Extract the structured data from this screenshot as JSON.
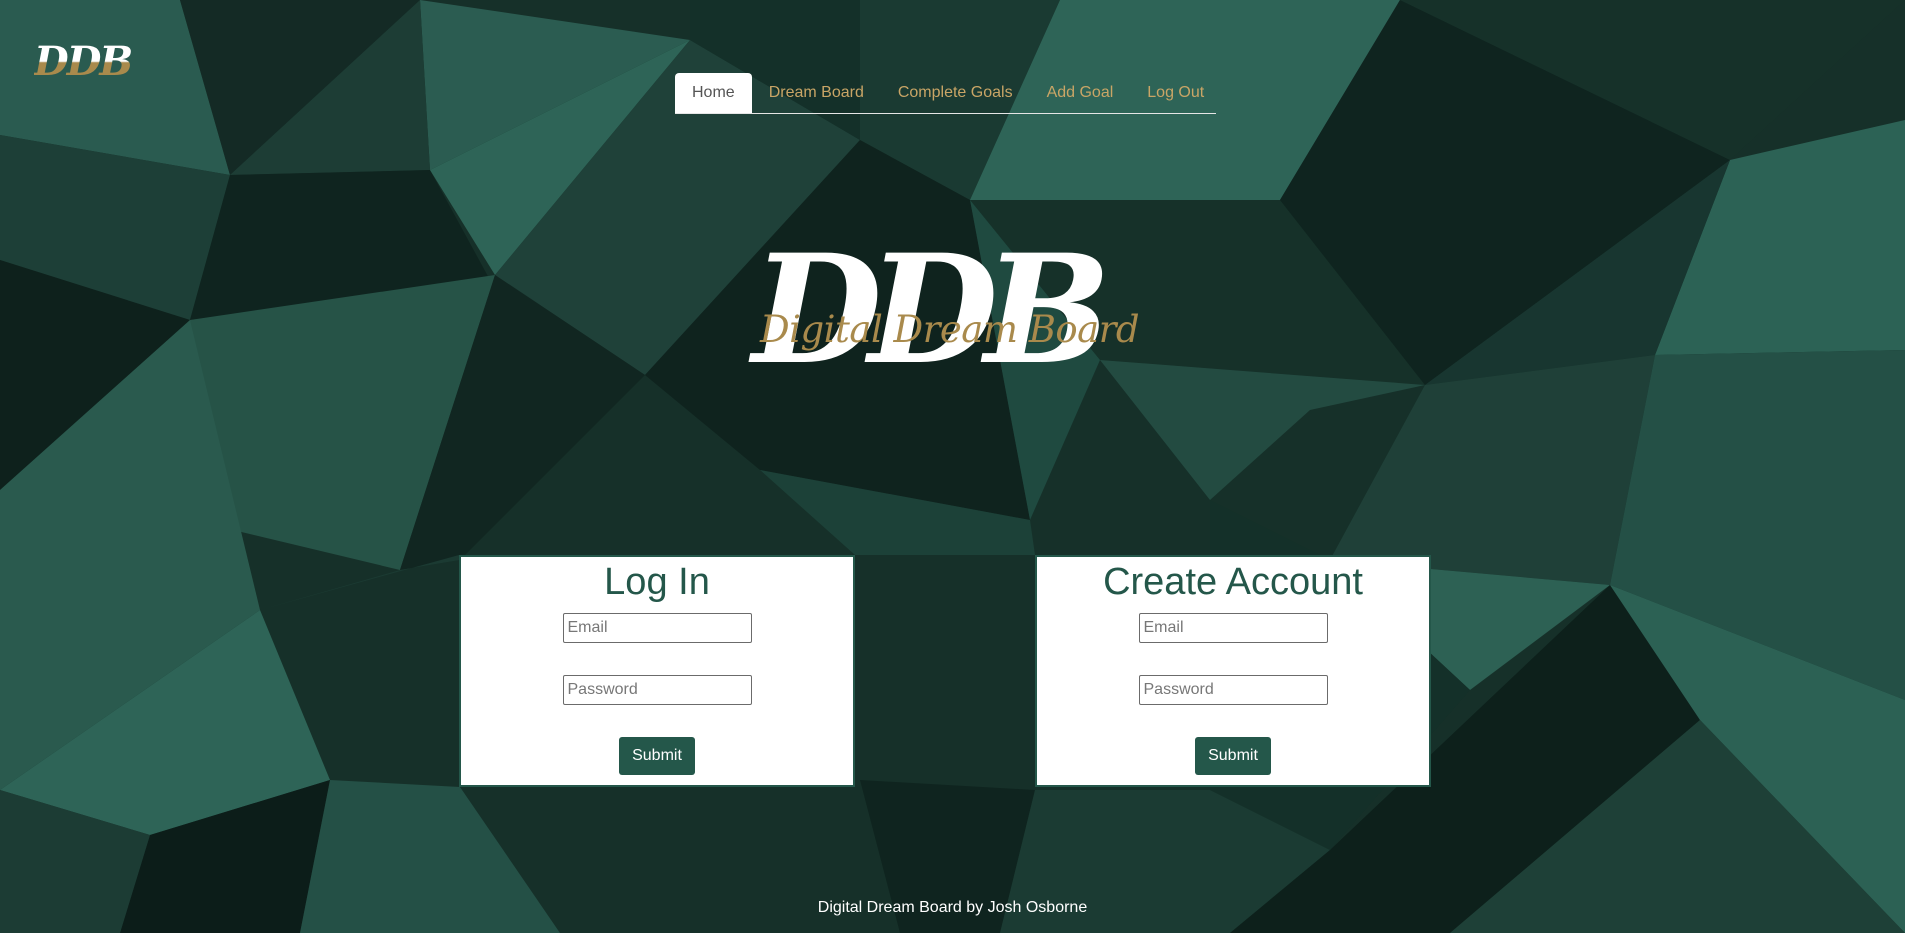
{
  "colors": {
    "brand_green": "#24574a",
    "gold": "#c9a566",
    "background_dark": "#163029"
  },
  "header": {
    "logo_text": "DDB"
  },
  "nav": {
    "items": [
      {
        "label": "Home",
        "active": true
      },
      {
        "label": "Dream Board",
        "active": false
      },
      {
        "label": "Complete Goals",
        "active": false
      },
      {
        "label": "Add Goal",
        "active": false
      },
      {
        "label": "Log Out",
        "active": false
      }
    ]
  },
  "hero": {
    "logo_letters": "DDB",
    "logo_subtitle": "Digital Dream Board"
  },
  "login": {
    "title": "Log In",
    "email_placeholder": "Email",
    "password_placeholder": "Password",
    "submit_label": "Submit"
  },
  "create_account": {
    "title": "Create Account",
    "email_placeholder": "Email",
    "password_placeholder": "Password",
    "submit_label": "Submit"
  },
  "footer": {
    "text": "Digital Dream Board by Josh Osborne"
  }
}
